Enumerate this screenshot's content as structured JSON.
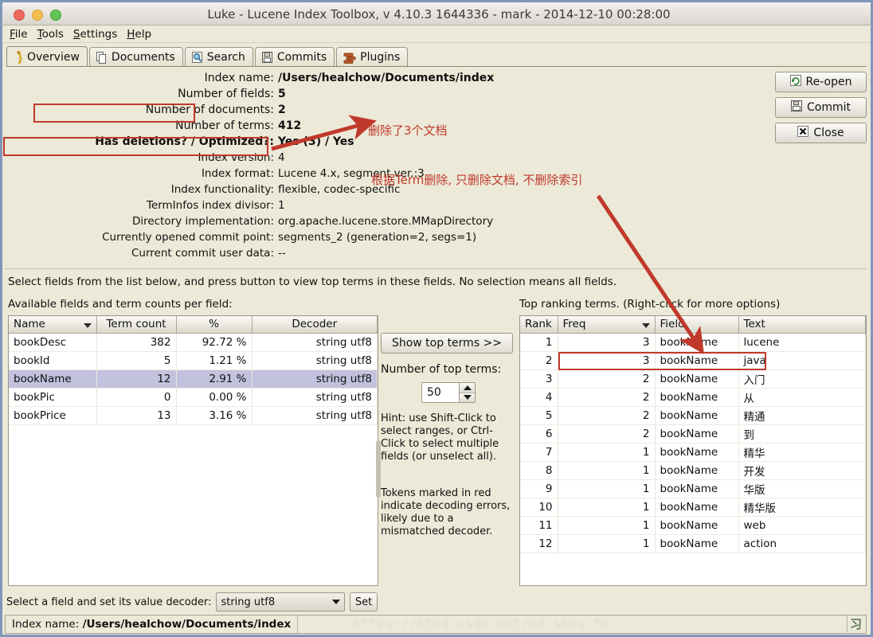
{
  "window": {
    "title": "Luke - Lucene Index Toolbox, v 4.10.3 1644336 - mark - 2014-12-10 00:28:00",
    "traffic_lights": [
      "close-red",
      "minimize-amber",
      "zoom-green"
    ]
  },
  "menubar": [
    {
      "label": "File",
      "mnemonic": "F"
    },
    {
      "label": "Tools",
      "mnemonic": "T"
    },
    {
      "label": "Settings",
      "mnemonic": "S"
    },
    {
      "label": "Help",
      "mnemonic": "H"
    }
  ],
  "tabs": [
    {
      "label": "Overview",
      "icon": "bug-icon",
      "active": true
    },
    {
      "label": "Documents",
      "icon": "documents-icon",
      "active": false
    },
    {
      "label": "Search",
      "icon": "magnifier-icon",
      "active": false
    },
    {
      "label": "Commits",
      "icon": "floppy-icon",
      "active": false
    },
    {
      "label": "Plugins",
      "icon": "plugins-icon",
      "active": false
    }
  ],
  "overview": {
    "rows": [
      {
        "label": "Index name:",
        "value": "/Users/healchow/Documents/index",
        "style": "big"
      },
      {
        "label": "Number of fields:",
        "value": "5",
        "style": "big"
      },
      {
        "label": "Number of documents:",
        "value": "2",
        "style": "big"
      },
      {
        "label": "Number of terms:",
        "value": "412",
        "style": "big"
      },
      {
        "label": "Has deletions? / Optimized?:",
        "value": "Yes (3)  /  Yes",
        "style": "strong"
      },
      {
        "label": "Index version:",
        "value": "4",
        "style": "plain"
      },
      {
        "label": "Index format:",
        "value": "Lucene 4.x, segment ver.:3",
        "style": "plain"
      },
      {
        "label": "Index functionality:",
        "value": "flexible, codec-specific",
        "style": "plain"
      },
      {
        "label": "TermInfos index divisor:",
        "value": "1",
        "style": "plain"
      },
      {
        "label": "Directory implementation:",
        "value": "org.apache.lucene.store.MMapDirectory",
        "style": "plain"
      },
      {
        "label": "Currently opened commit point:",
        "value": "segments_2 (generation=2, segs=1)",
        "style": "plain"
      },
      {
        "label": "Current commit user data:",
        "value": "--",
        "style": "plain"
      }
    ]
  },
  "side_buttons": [
    {
      "label": "Re-open",
      "icon": "refresh-icon"
    },
    {
      "label": "Commit",
      "icon": "floppy-icon"
    },
    {
      "label": "Close",
      "icon": "close-x-icon"
    }
  ],
  "instructions": {
    "select_fields": "Select fields from the list below, and press button to view top terms in these fields. No selection means all fields.",
    "available_fields": "Available fields and term counts per field:",
    "top_ranking": "Top ranking terms. (Right-click for more options)"
  },
  "fields_table": {
    "columns": [
      "Name",
      "Term count",
      "%",
      "Decoder"
    ],
    "sorted_column": "Name",
    "rows": [
      {
        "name": "bookDesc",
        "term_count": "382",
        "percent": "92.72 %",
        "decoder": "string utf8",
        "selected": false
      },
      {
        "name": "bookId",
        "term_count": "5",
        "percent": "1.21 %",
        "decoder": "string utf8",
        "selected": false
      },
      {
        "name": "bookName",
        "term_count": "12",
        "percent": "2.91 %",
        "decoder": "string utf8",
        "selected": true
      },
      {
        "name": "bookPic",
        "term_count": "0",
        "percent": "0.00 %",
        "decoder": "string utf8",
        "selected": false
      },
      {
        "name": "bookPrice",
        "term_count": "13",
        "percent": "3.16 %",
        "decoder": "string utf8",
        "selected": false
      }
    ]
  },
  "middle_panel": {
    "show_top_terms_label": "Show top terms >>",
    "number_of_top_terms_label": "Number of top terms:",
    "number_of_top_terms_value": "50",
    "hint1": "Hint: use Shift-Click to select ranges, or Ctrl-Click to select multiple fields (or unselect all).",
    "hint2": "Tokens marked in red indicate decoding errors, likely due to a mismatched decoder."
  },
  "terms_table": {
    "columns": [
      "Rank",
      "Freq",
      "Field",
      "Text"
    ],
    "sorted_column": "Freq",
    "rows": [
      {
        "rank": "1",
        "freq": "3",
        "field": "bookName",
        "text": "lucene",
        "highlighted": false
      },
      {
        "rank": "2",
        "freq": "3",
        "field": "bookName",
        "text": "java",
        "highlighted": true
      },
      {
        "rank": "3",
        "freq": "2",
        "field": "bookName",
        "text": "入门",
        "highlighted": false
      },
      {
        "rank": "4",
        "freq": "2",
        "field": "bookName",
        "text": "从",
        "highlighted": false
      },
      {
        "rank": "5",
        "freq": "2",
        "field": "bookName",
        "text": "精通",
        "highlighted": false
      },
      {
        "rank": "6",
        "freq": "2",
        "field": "bookName",
        "text": "到",
        "highlighted": false
      },
      {
        "rank": "7",
        "freq": "1",
        "field": "bookName",
        "text": "精华",
        "highlighted": false
      },
      {
        "rank": "8",
        "freq": "1",
        "field": "bookName",
        "text": "开发",
        "highlighted": false
      },
      {
        "rank": "9",
        "freq": "1",
        "field": "bookName",
        "text": "华版",
        "highlighted": false
      },
      {
        "rank": "10",
        "freq": "1",
        "field": "bookName",
        "text": "精华版",
        "highlighted": false
      },
      {
        "rank": "11",
        "freq": "1",
        "field": "bookName",
        "text": "web",
        "highlighted": false
      },
      {
        "rank": "12",
        "freq": "1",
        "field": "bookName",
        "text": "action",
        "highlighted": false
      }
    ]
  },
  "decoder_bar": {
    "label": "Select a field and set its value decoder:",
    "selected_decoder": "string utf8",
    "set_label": "Set"
  },
  "statusbar": {
    "index_name_label": "Index name:",
    "index_name_value": "/Users/healchow/Documents/index",
    "watermark": "https://blog.csdn.net/ma_shou_fe"
  },
  "annotations": {
    "accent_color": "#c0392b",
    "note1": "删除了3个文档",
    "note2": "根据Term删除, 只删除文档, 不删除索引"
  }
}
